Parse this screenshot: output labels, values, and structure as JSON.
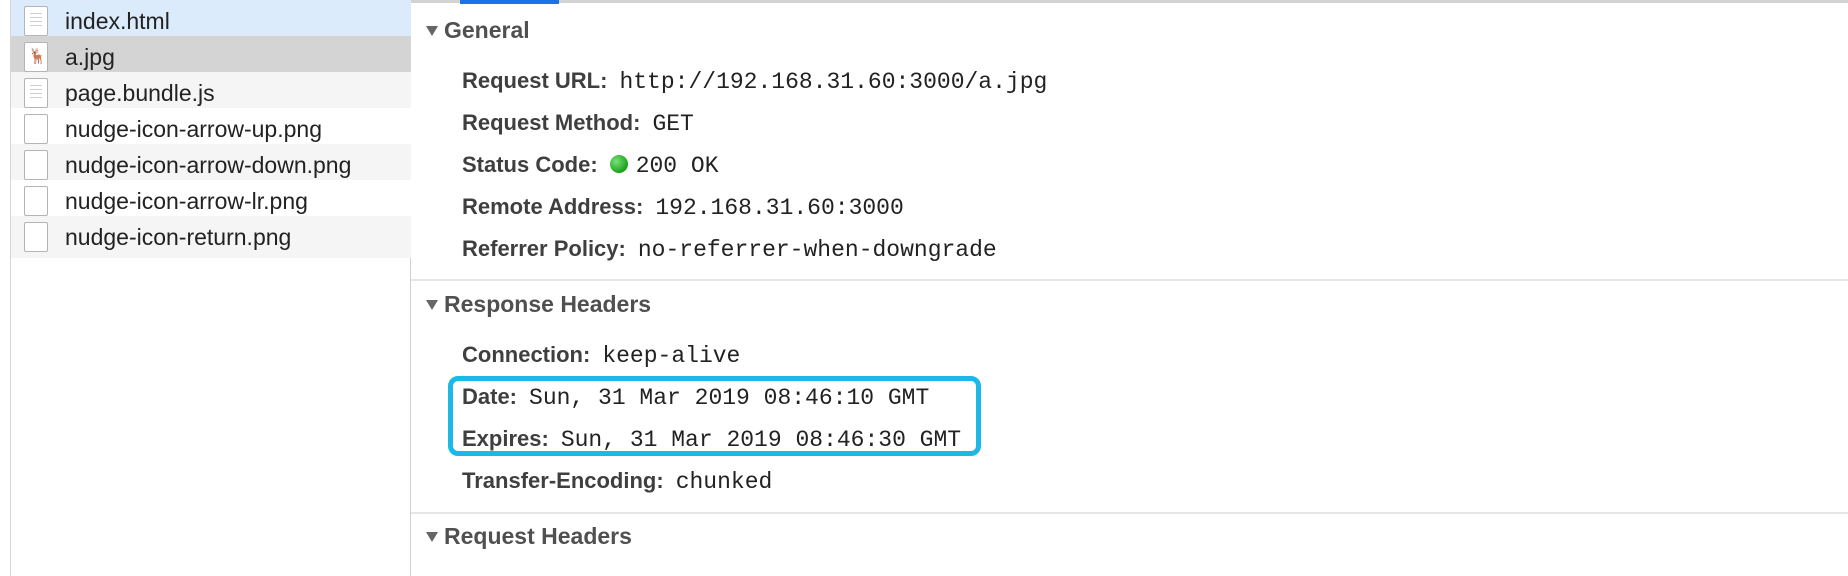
{
  "files": [
    {
      "name": "index.html",
      "icon": "document-icon",
      "state": "selected"
    },
    {
      "name": "a.jpg",
      "icon": "image-icon",
      "state": "active"
    },
    {
      "name": "page.bundle.js",
      "icon": "document-icon",
      "state": "normal"
    },
    {
      "name": "nudge-icon-arrow-up.png",
      "icon": "blank-file-icon",
      "state": "normal"
    },
    {
      "name": "nudge-icon-arrow-down.png",
      "icon": "blank-file-icon",
      "state": "normal"
    },
    {
      "name": "nudge-icon-arrow-lr.png",
      "icon": "blank-file-icon",
      "state": "normal"
    },
    {
      "name": "nudge-icon-return.png",
      "icon": "blank-file-icon",
      "state": "normal"
    }
  ],
  "general": {
    "title": "General",
    "request_url_label": "Request URL:",
    "request_url": "http://192.168.31.60:3000/a.jpg",
    "request_method_label": "Request Method:",
    "request_method": "GET",
    "status_code_label": "Status Code:",
    "status_code": "200 OK",
    "remote_address_label": "Remote Address:",
    "remote_address": "192.168.31.60:3000",
    "referrer_policy_label": "Referrer Policy:",
    "referrer_policy": "no-referrer-when-downgrade"
  },
  "response_headers": {
    "title": "Response Headers",
    "connection_label": "Connection:",
    "connection": "keep-alive",
    "date_label": "Date:",
    "date": "Sun, 31 Mar 2019 08:46:10 GMT",
    "expires_label": "Expires:",
    "expires": "Sun, 31 Mar 2019 08:46:30 GMT",
    "transfer_encoding_label": "Transfer-Encoding:",
    "transfer_encoding": "chunked"
  },
  "request_headers": {
    "title": "Request Headers"
  },
  "colors": {
    "selected_row": "#dcebfc",
    "active_row": "#d4d4d4",
    "striped_row": "#f5f5f5",
    "highlight_border": "#1cb9e8",
    "status_ok": "#1aa31a",
    "active_tab": "#1a73e8"
  }
}
